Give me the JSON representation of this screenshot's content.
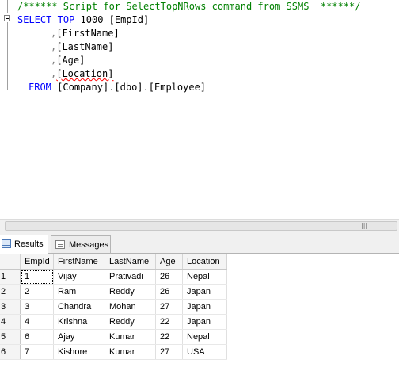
{
  "editor": {
    "comment": "/****** Script for SelectTopNRows command from SSMS  ******/",
    "select_kw": "SELECT",
    "top_kw": "TOP",
    "top_value": "1000",
    "col1": "[EmpId]",
    "col2": "[FirstName]",
    "col3": "[LastName]",
    "col4": "[Age]",
    "col5": "[Location]",
    "comma": ",",
    "from_kw": "FROM",
    "from_db": "[Company]",
    "from_schema": "[dbo]",
    "from_table": "[Employee]",
    "dot": "."
  },
  "tabs": {
    "results": "Results",
    "messages": "Messages"
  },
  "grid": {
    "columns": [
      "",
      "EmpId",
      "FirstName",
      "LastName",
      "Age",
      "Location"
    ],
    "rows": [
      [
        "1",
        "1",
        "Vijay",
        "Prativadi",
        "26",
        "Nepal"
      ],
      [
        "2",
        "2",
        "Ram",
        "Reddy",
        "26",
        "Japan"
      ],
      [
        "3",
        "3",
        "Chandra",
        "Mohan",
        "27",
        "Japan"
      ],
      [
        "4",
        "4",
        "Krishna",
        "Reddy",
        "22",
        "Japan"
      ],
      [
        "5",
        "6",
        "Ajay",
        "Kumar",
        "22",
        "Nepal"
      ],
      [
        "6",
        "7",
        "Kishore",
        "Kumar",
        "27",
        "USA"
      ]
    ]
  }
}
